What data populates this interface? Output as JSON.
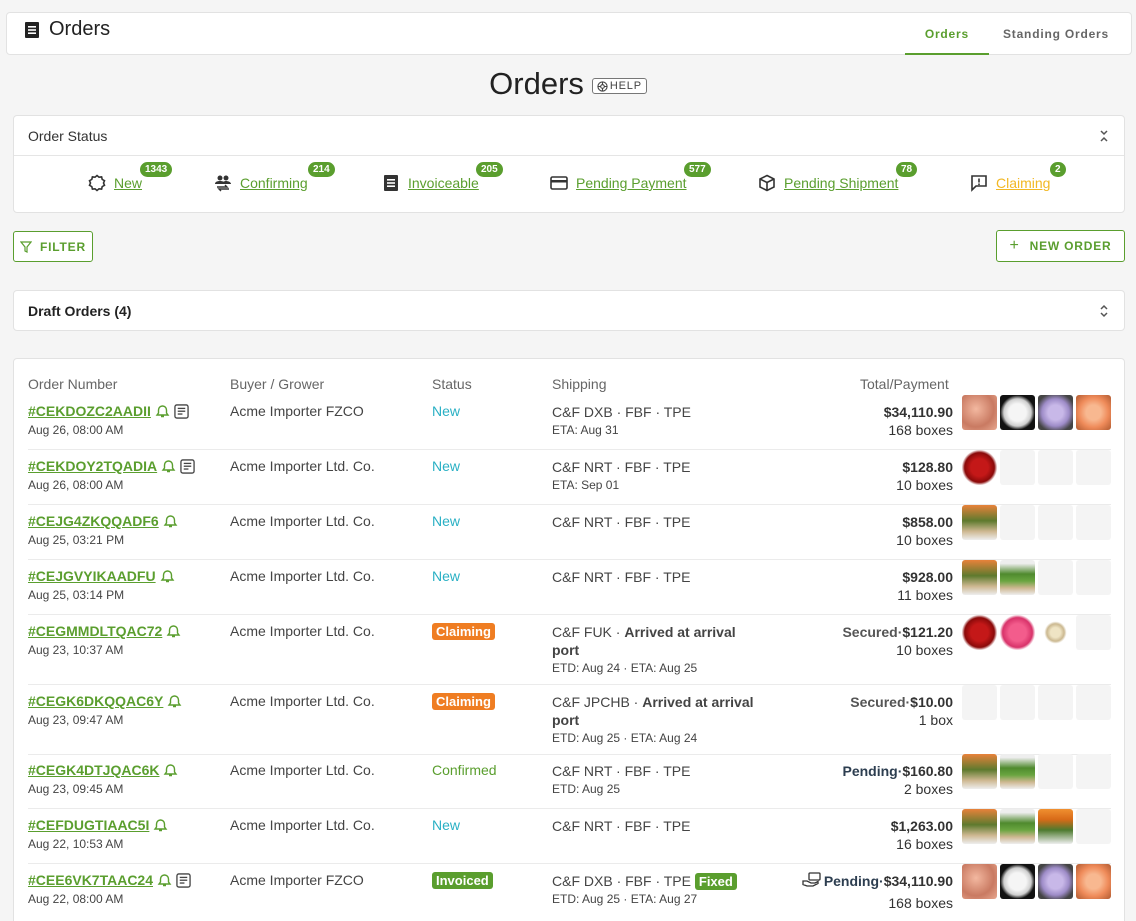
{
  "header": {
    "app_title": "Orders",
    "tabs": [
      {
        "label": "Orders",
        "active": true
      },
      {
        "label": "Standing Orders",
        "active": false
      }
    ]
  },
  "page": {
    "title": "Orders",
    "help_label": "HELP"
  },
  "order_status": {
    "title": "Order Status",
    "items": [
      {
        "label": "New",
        "count": "1343",
        "icon": "gear-icon"
      },
      {
        "label": "Confirming",
        "count": "214",
        "icon": "users-transfer-icon"
      },
      {
        "label": "Invoiceable",
        "count": "205",
        "icon": "receipt-icon"
      },
      {
        "label": "Pending Payment",
        "count": "577",
        "icon": "credit-card-icon"
      },
      {
        "label": "Pending Shipment",
        "count": "78",
        "icon": "box-icon"
      },
      {
        "label": "Claiming",
        "count": "2",
        "icon": "alert-message-icon"
      }
    ]
  },
  "actions": {
    "filter_label": "FILTER",
    "new_order_label": "NEW ORDER"
  },
  "drafts": {
    "label": "Draft Orders (4)"
  },
  "table": {
    "columns": [
      "Order Number",
      "Buyer / Grower",
      "Status",
      "Shipping",
      "Total/Payment"
    ],
    "rows": [
      {
        "order": "#CEKDOZC2AADII",
        "date": "Aug 26, 08:00 AM",
        "buyer": "Acme Importer FZCO",
        "status": "New",
        "ship": "C&F DXB · FBF · TPE",
        "ship_note": "ETA: Aug 31",
        "total_prefix": "",
        "total": "$34,110.90",
        "boxes": "168 boxes"
      },
      {
        "order": "#CEKDOY2TQADIA",
        "date": "Aug 26, 08:00 AM",
        "buyer": "Acme Importer Ltd. Co.",
        "status": "New",
        "ship": "C&F NRT · FBF · TPE",
        "ship_note": "ETA: Sep 01",
        "total_prefix": "",
        "total": "$128.80",
        "boxes": "10 boxes"
      },
      {
        "order": "#CEJG4ZKQQADF6",
        "date": "Aug 25, 03:21 PM",
        "buyer": "Acme Importer Ltd. Co.",
        "status": "New",
        "ship": "C&F NRT · FBF · TPE",
        "ship_note": "",
        "total_prefix": "",
        "total": "$858.00",
        "boxes": "10 boxes"
      },
      {
        "order": "#CEJGVYIKAADFU",
        "date": "Aug 25, 03:14 PM",
        "buyer": "Acme Importer Ltd. Co.",
        "status": "New",
        "ship": "C&F NRT · FBF · TPE",
        "ship_note": "",
        "total_prefix": "",
        "total": "$928.00",
        "boxes": "11 boxes"
      },
      {
        "order": "#CEGMMDLTQAC72",
        "date": "Aug 23, 10:37 AM",
        "buyer": "Acme Importer Ltd. Co.",
        "status": "Claiming",
        "ship_prefix": "C&F FUK · ",
        "ship_bold": "Arrived at arrival port",
        "ship_note": "ETD: Aug 24 · ETA: Aug 25",
        "total_prefix": "Secured·",
        "total": "$121.20",
        "boxes": "10 boxes"
      },
      {
        "order": "#CEGK6DKQQAC6Y",
        "date": "Aug 23, 09:47 AM",
        "buyer": "Acme Importer Ltd. Co.",
        "status": "Claiming",
        "ship_prefix": "C&F JPCHB · ",
        "ship_bold": "Arrived at arrival port",
        "ship_note": "ETD: Aug 25 · ETA: Aug 24",
        "total_prefix": "Secured·",
        "total": "$10.00",
        "boxes": "1 box"
      },
      {
        "order": "#CEGK4DTJQAC6K",
        "date": "Aug 23, 09:45 AM",
        "buyer": "Acme Importer Ltd. Co.",
        "status": "Confirmed",
        "ship": "C&F NRT · FBF · TPE",
        "ship_note": "ETD: Aug 25",
        "total_prefix": "Pending·",
        "total": "$160.80",
        "boxes": "2 boxes"
      },
      {
        "order": "#CEFDUGTIAAC5I",
        "date": "Aug 22, 10:53 AM",
        "buyer": "Acme Importer Ltd. Co.",
        "status": "New",
        "ship": "C&F NRT · FBF · TPE",
        "ship_note": "",
        "total_prefix": "",
        "total": "$1,263.00",
        "boxes": "16 boxes"
      },
      {
        "order": "#CEE6VK7TAAC24",
        "date": "Aug 22, 08:00 AM",
        "buyer": "Acme Importer FZCO",
        "status": "Invoiced",
        "ship": "C&F DXB · FBF · TPE",
        "ship_tag": "Fixed",
        "ship_note": "ETD: Aug 25 · ETA: Aug 27",
        "total_prefix": "Pending·",
        "total": "$34,110.90",
        "boxes": "168 boxes"
      }
    ]
  },
  "colors": {
    "accent": "#5a9e2e",
    "new": "#29b0c4",
    "claiming": "#ef7d22",
    "claiming_link": "#f2b824"
  }
}
